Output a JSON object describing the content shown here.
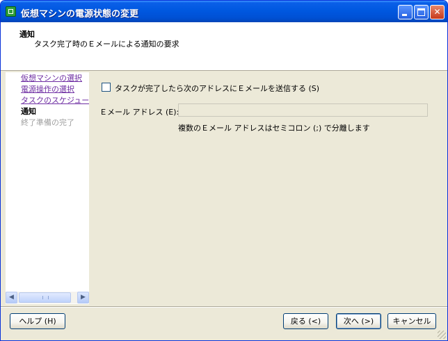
{
  "window": {
    "title": "仮想マシンの電源状態の変更"
  },
  "header": {
    "title": "通知",
    "subtitle": "タスク完了時のＥメールによる通知の要求"
  },
  "sidebar": {
    "steps": [
      {
        "label": "仮想マシンの選択",
        "state": "link"
      },
      {
        "label": "電源操作の選択",
        "state": "link"
      },
      {
        "label": "タスクのスケジュール設定",
        "state": "link"
      },
      {
        "label": "通知",
        "state": "current"
      },
      {
        "label": "終了準備の完了",
        "state": "disabled"
      }
    ]
  },
  "form": {
    "checkbox_label": "タスクが完了したら次のアドレスにＥメールを送信する (S)",
    "checkbox_checked": false,
    "email_label": "Ｅメール アドレス (E):",
    "email_value": "",
    "email_hint": "複数のＥメール アドレスはセミコロン (;) で分離します"
  },
  "buttons": {
    "help": "ヘルプ (H)",
    "back": "戻る (<)",
    "next": "次へ (>)",
    "cancel": "キャンセル"
  },
  "icons": {
    "app": "vm-power-icon",
    "minimize": "minimize-icon",
    "maximize": "maximize-icon",
    "close": "close-icon"
  }
}
